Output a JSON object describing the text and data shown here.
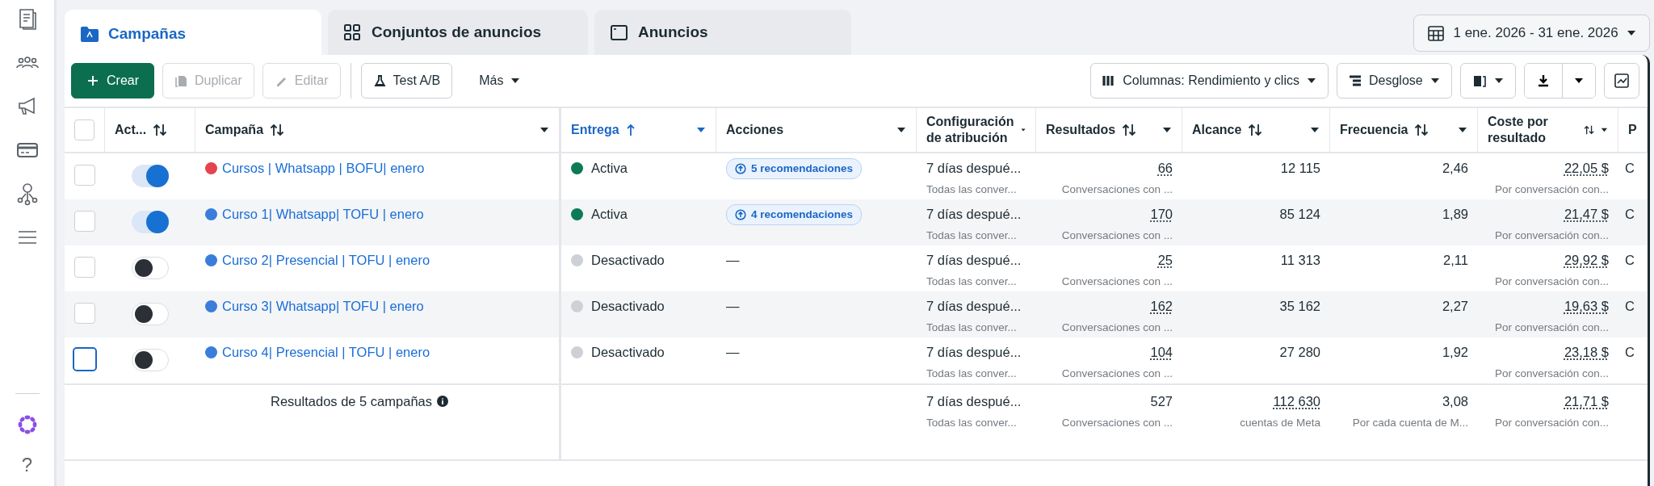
{
  "sidebar": {
    "help": "?"
  },
  "tabs": [
    {
      "label": "Campañas",
      "selected": true
    },
    {
      "label": "Conjuntos de anuncios",
      "selected": false
    },
    {
      "label": "Anuncios",
      "selected": false
    }
  ],
  "date_range": "1 ene. 2026 - 31 ene. 2026",
  "toolbar_left": [
    {
      "label": "Crear",
      "kind": "primary",
      "disabled": false
    },
    {
      "label": "Duplicar",
      "kind": "plain",
      "disabled": true
    },
    {
      "label": "Editar",
      "kind": "plain",
      "disabled": true
    },
    {
      "label": "Test A/B",
      "kind": "plain",
      "disabled": false
    },
    {
      "label": "Más",
      "kind": "menu",
      "disabled": false
    }
  ],
  "toolbar_right": [
    {
      "label": "Columnas: Rendimiento y clics"
    },
    {
      "label": "Desglose"
    }
  ],
  "table": {
    "select_all": {
      "checked": false
    },
    "columns": [
      {
        "label": "Act...",
        "sortable": true,
        "menu": false,
        "sorted": false
      },
      {
        "label": "Campaña",
        "sortable": true,
        "menu": true,
        "sorted": false
      },
      {
        "label": "Entrega",
        "sortable": true,
        "menu": true,
        "sorted": true
      },
      {
        "label": "Acciones",
        "sortable": false,
        "menu": true,
        "sorted": false
      },
      {
        "label": "Configuración de atribución",
        "sortable": false,
        "menu": true,
        "sorted": false
      },
      {
        "label": "Resultados",
        "sortable": true,
        "menu": true,
        "sorted": false
      },
      {
        "label": "Alcance",
        "sortable": true,
        "menu": true,
        "sorted": false
      },
      {
        "label": "Frecuencia",
        "sortable": true,
        "menu": true,
        "sorted": false
      },
      {
        "label": "Coste por resultado",
        "sortable": true,
        "menu": true,
        "sorted": false
      },
      {
        "label": "P",
        "sortable": false,
        "menu": false,
        "sorted": false
      }
    ],
    "rows": [
      {
        "checked": false,
        "focused": false,
        "on": true,
        "color": "#e5434f",
        "name": "Cursos | Whatsapp | BOFU| enero",
        "delivery": {
          "text": "Activa",
          "color": "#0b7a55"
        },
        "actions": {
          "kind": "recommendation",
          "text": "5 recomendaciones"
        },
        "attribution": "7 días despué...",
        "attribution_note": "Todas las conver...",
        "results": "66",
        "results_note": "Conversaciones con ...",
        "reach": "12 115",
        "frequency": "2,46",
        "cost": "22,05 $",
        "cost_note": "Por conversación con...",
        "column_p": "C"
      },
      {
        "checked": false,
        "focused": false,
        "on": true,
        "color": "#3b7ddb",
        "name": "Curso 1| Whatsapp| TOFU | enero",
        "delivery": {
          "text": "Activa",
          "color": "#0b7a55"
        },
        "actions": {
          "kind": "recommendation",
          "text": "4 recomendaciones"
        },
        "attribution": "7 días despué...",
        "attribution_note": "Todas las conver...",
        "results": "170",
        "results_note": "Conversaciones con ...",
        "reach": "85 124",
        "frequency": "1,89",
        "cost": "21,47 $",
        "cost_note": "Por conversación con...",
        "column_p": "C"
      },
      {
        "checked": false,
        "focused": false,
        "on": false,
        "color": "#3b7ddb",
        "name": "Curso 2| Presencial | TOFU | enero",
        "delivery": {
          "text": "Desactivado",
          "color": "#cdd0d5"
        },
        "actions": {
          "kind": "none",
          "text": "—"
        },
        "attribution": "7 días despué...",
        "attribution_note": "Todas las conver...",
        "results": "25",
        "results_note": "Conversaciones con ...",
        "reach": "11 313",
        "frequency": "2,11",
        "cost": "29,92 $",
        "cost_note": "Por conversación con...",
        "column_p": "C"
      },
      {
        "checked": false,
        "focused": false,
        "on": false,
        "color": "#3b7ddb",
        "name": "Curso 3| Whatsapp| TOFU | enero",
        "delivery": {
          "text": "Desactivado",
          "color": "#cdd0d5"
        },
        "actions": {
          "kind": "none",
          "text": "—"
        },
        "attribution": "7 días despué...",
        "attribution_note": "Todas las conver...",
        "results": "162",
        "results_note": "Conversaciones con ...",
        "reach": "35 162",
        "frequency": "2,27",
        "cost": "19,63 $",
        "cost_note": "Por conversación con...",
        "column_p": "C"
      },
      {
        "checked": false,
        "focused": true,
        "on": false,
        "color": "#3b7ddb",
        "name": "Curso 4| Presencial | TOFU | enero",
        "delivery": {
          "text": "Desactivado",
          "color": "#cdd0d5"
        },
        "actions": {
          "kind": "none",
          "text": "—"
        },
        "attribution": "7 días despué...",
        "attribution_note": "Todas las conver...",
        "results": "104",
        "results_note": "Conversaciones con ...",
        "reach": "27 280",
        "frequency": "1,92",
        "cost": "23,18 $",
        "cost_note": "Por conversación con...",
        "column_p": "C"
      }
    ],
    "footer": {
      "label": "Resultados de 5 campañas",
      "attribution": "7 días despué...",
      "attribution_note": "Todas las conver...",
      "results": "527",
      "results_note": "Conversaciones con ...",
      "reach": "112 630",
      "reach_note": "cuentas de Meta",
      "frequency": "3,08",
      "frequency_note": "Por cada cuenta de M...",
      "cost": "21,71 $",
      "cost_note": "Por conversación con..."
    }
  }
}
